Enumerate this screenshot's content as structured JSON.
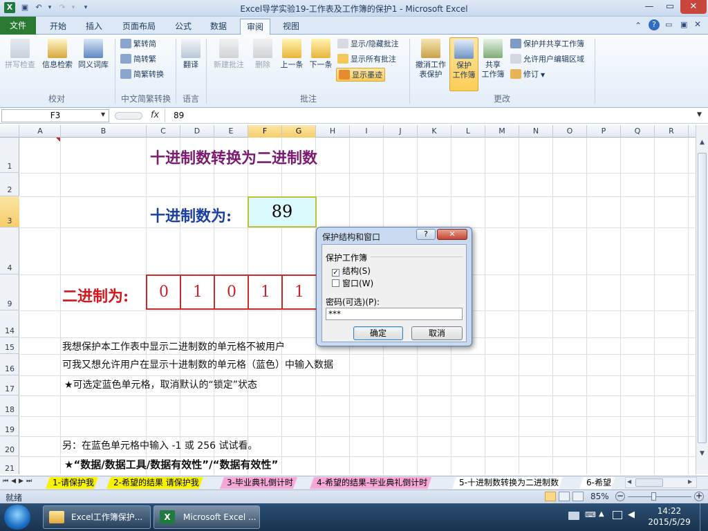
{
  "window": {
    "title": "Excel导学实验19-工作表及工作簿的保护1 - Microsoft Excel",
    "minimize_glyph": "—",
    "restore_glyph": "▭",
    "close_glyph": "✕"
  },
  "tabs": {
    "file": "文件",
    "items": [
      "开始",
      "插入",
      "页面布局",
      "公式",
      "数据",
      "审阅",
      "视图"
    ]
  },
  "ribbon": {
    "proofing": {
      "group": "校对",
      "spell": "拼写检查",
      "research": "信息检索",
      "thesaurus": "同义词库"
    },
    "chinese": {
      "group": "中文简繁转换",
      "t2s": "繁转简",
      "s2t": "简转繁",
      "convert": "简繁转换"
    },
    "language": {
      "group": "语言",
      "translate": "翻译"
    },
    "comments": {
      "group": "批注",
      "new": "新建批注",
      "delete": "删除",
      "prev": "上一条",
      "next": "下一条",
      "show_hide": "显示/隐藏批注",
      "show_all": "显示所有批注",
      "show_ink": "显示墨迹"
    },
    "changes": {
      "group": "更改",
      "unprotect_sheet_1": "撤消工作",
      "unprotect_sheet_2": "表保护",
      "protect_wb_1": "保护",
      "protect_wb_2": "工作簿",
      "share_1": "共享",
      "share_2": "工作簿",
      "protect_share": "保护并共享工作簿",
      "allow_edit": "允许用户编辑区域",
      "track": "修订"
    }
  },
  "formula_bar": {
    "name_box": "F3",
    "fx": "fx",
    "value": "89"
  },
  "columns": [
    "A",
    "B",
    "C",
    "D",
    "E",
    "F",
    "G",
    "H",
    "I",
    "J",
    "K",
    "L",
    "M",
    "N",
    "O",
    "P",
    "Q",
    "R"
  ],
  "rows": [
    "1",
    "2",
    "3",
    "4",
    "9",
    "14",
    "15",
    "16",
    "17",
    "18",
    "19",
    "20",
    "21"
  ],
  "sheet": {
    "title": "十进制数转换为二进制数",
    "decimal_label": "十进制数为:",
    "decimal_value": "89",
    "binary_label": "二进制为:",
    "bits": [
      "0",
      "1",
      "0",
      "1",
      "1"
    ],
    "note1": "我想保护本工作表中显示二进制数的单元格不被用户",
    "note2": "可我又想允许用户在显示十进制数的单元格（蓝色）中输入数据",
    "note3": "★可选定蓝色单元格，取消默认的“锁定”状态",
    "note4": "另：在蓝色单元格中输入 -1 或 256 试试看。",
    "note5": "★“数据/数据工具/数据有效性”/“数据有效性”"
  },
  "sheet_tabs": [
    {
      "label": "1-请保护我",
      "color": "#f8f200"
    },
    {
      "label": "2-希望的结果 请保护我",
      "color": "#f8f200"
    },
    {
      "label": "3-毕业典礼倒计时",
      "color": "#f7a8d8"
    },
    {
      "label": "4-希望的结果-毕业典礼倒计时",
      "color": "#f7a8d8"
    },
    {
      "label": "5-十进制数转换为二进制数",
      "color": "#ffffff"
    },
    {
      "label": "6-希望",
      "color": "#ffffff"
    }
  ],
  "status": {
    "ready": "就绪",
    "zoom": "85%"
  },
  "dialog": {
    "title": "保护结构和窗口",
    "help": "?",
    "close": "✕",
    "section": "保护工作簿",
    "structure": "结构(S)",
    "structure_checked": true,
    "windows": "窗口(W)",
    "windows_checked": false,
    "password_label": "密码(可选)(P):",
    "password_value": "***",
    "ok": "确定",
    "cancel": "取消"
  },
  "taskbar": {
    "start": "start-orb-icon",
    "task1": "Excel工作簿保护...",
    "task2": "Microsoft Excel ...",
    "time": "14:22",
    "date": "2015/5/29"
  }
}
